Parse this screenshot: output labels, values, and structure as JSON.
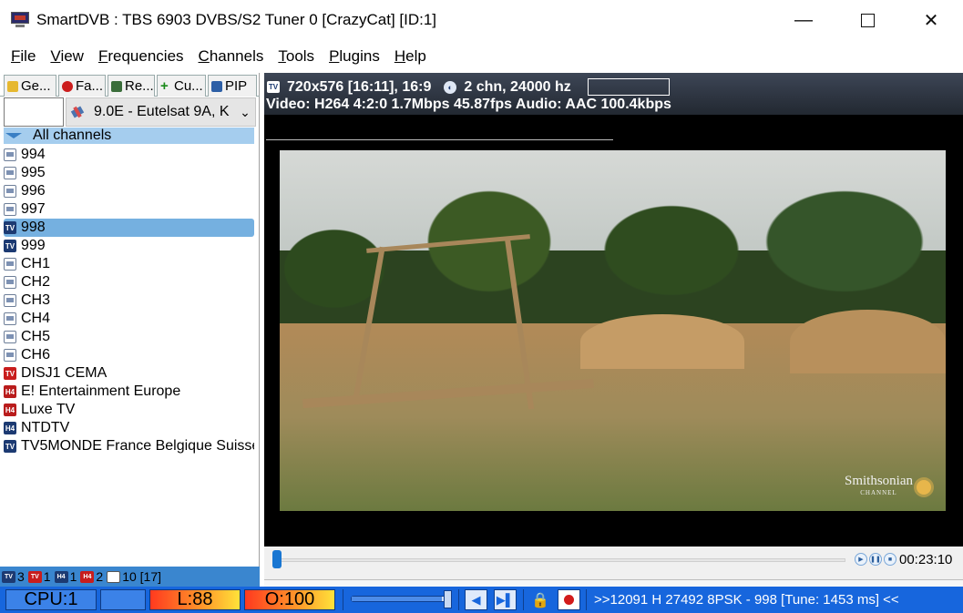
{
  "window": {
    "title": "SmartDVB : TBS 6903 DVBS/S2 Tuner 0 [CrazyCat] [ID:1]",
    "minimize_label": "—",
    "close_label": "✕"
  },
  "menu": [
    "File",
    "View",
    "Frequencies",
    "Channels",
    "Tools",
    "Plugins",
    "Help"
  ],
  "tabs": [
    {
      "label": "Ge...",
      "icon": "star-folder-icon"
    },
    {
      "label": "Fa...",
      "icon": "favorites-icon"
    },
    {
      "label": "Re...",
      "icon": "recent-icon"
    },
    {
      "label": "Cu...",
      "icon": "plus-icon"
    },
    {
      "label": "PIP",
      "icon": "pip-icon"
    }
  ],
  "satellite": {
    "selected": "9.0E -  Eutelsat 9A, K",
    "chevron": "⌄"
  },
  "channel_tree": {
    "group": "All channels",
    "channels": [
      {
        "name": "994",
        "type": "radio",
        "selected": false
      },
      {
        "name": "995",
        "type": "radio",
        "selected": false
      },
      {
        "name": "996",
        "type": "radio",
        "selected": false
      },
      {
        "name": "997",
        "type": "radio",
        "selected": false
      },
      {
        "name": "998",
        "type": "tv",
        "selected": true
      },
      {
        "name": "999",
        "type": "tv",
        "selected": false
      },
      {
        "name": "CH1",
        "type": "radio",
        "selected": false
      },
      {
        "name": "CH2",
        "type": "radio",
        "selected": false
      },
      {
        "name": "CH3",
        "type": "radio",
        "selected": false
      },
      {
        "name": "CH4",
        "type": "radio",
        "selected": false
      },
      {
        "name": "CH5",
        "type": "radio",
        "selected": false
      },
      {
        "name": "CH6",
        "type": "radio",
        "selected": false
      },
      {
        "name": "DISJ1  CEMA",
        "type": "tv-red",
        "selected": false
      },
      {
        "name": "E! Entertainment Europe",
        "type": "h4-red",
        "selected": false
      },
      {
        "name": "Luxe TV",
        "type": "h4-red",
        "selected": false
      },
      {
        "name": "NTDTV",
        "type": "h4-blue",
        "selected": false
      },
      {
        "name": "TV5MONDE France Belgique Suisse",
        "type": "tv",
        "selected": false
      }
    ]
  },
  "channel_counts": {
    "tv": "3",
    "tv_scrambled": "1",
    "hd": "1",
    "hd_scrambled": "2",
    "radio": "10 [17]",
    "icon_tv": "TV",
    "icon_hd": "H4"
  },
  "video_info": {
    "tv_icon_label": "TV",
    "resolution": "720x576 [16:11], 16:9",
    "audio_icon_label": "◐",
    "audio_channels": "2 chn, 24000 hz",
    "video_line": "Video: H264 4:2:0 1.7Mbps 45.87fps   Audio: AAC 100.4kbps"
  },
  "watermark": {
    "brand": "Smithsonian",
    "sub": "CHANNEL"
  },
  "playback": {
    "time": "00:23:10",
    "progress": 0.0,
    "rewind_label": "▶",
    "pause_label": "❚❚",
    "stop_label": "■"
  },
  "statusbar": {
    "cpu": "CPU:1",
    "level_left": "L:88",
    "level_right": "O:100",
    "volume": 0.96,
    "prev_label": "◀",
    "next_label": "▶▌",
    "lock_label": "🔒",
    "tune_info": ">>12091 H 27492 8PSK - 998 [Tune: 1453 ms] <<"
  },
  "colors": {
    "accent": "#1766dd",
    "selected_row": "#75b0e0",
    "group_row": "#a5cdee",
    "record": "#d21b1b"
  }
}
